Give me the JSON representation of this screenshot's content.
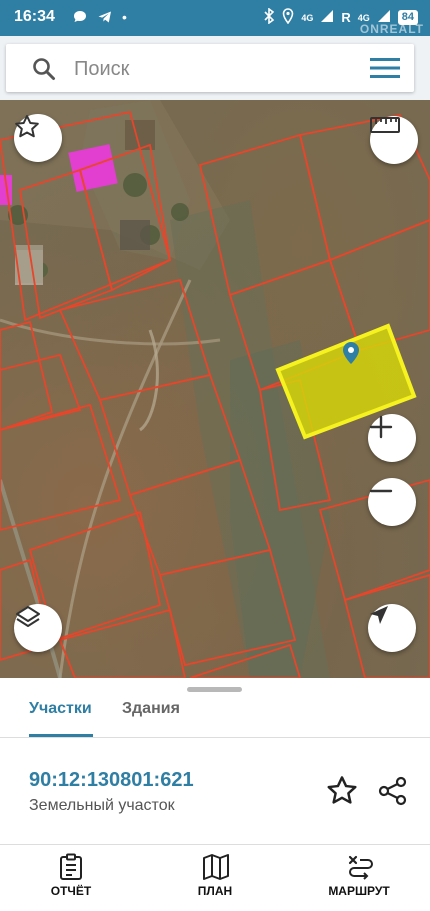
{
  "status_bar": {
    "time": "16:34",
    "network_1": "4G",
    "roaming": "R",
    "network_2": "4G",
    "battery": "84",
    "watermark": "ONREALT"
  },
  "search": {
    "placeholder": "Поиск"
  },
  "map": {
    "selected_parcel_color": "#d4d40a",
    "parcel_border_color": "#e8452a",
    "building_color": "#e23fd0"
  },
  "sheet": {
    "tabs": [
      {
        "label": "Участки",
        "active": true
      },
      {
        "label": "Здания",
        "active": false
      }
    ],
    "parcel": {
      "cadastral_number": "90:12:130801:621",
      "type": "Земельный участок"
    }
  },
  "bottom_nav": {
    "items": [
      {
        "label": "ОТЧЁТ",
        "icon": "report-icon"
      },
      {
        "label": "ПЛАН",
        "icon": "map-plan-icon"
      },
      {
        "label": "МАРШРУТ",
        "icon": "route-icon"
      }
    ]
  },
  "colors": {
    "accent": "#2f7ea4"
  }
}
